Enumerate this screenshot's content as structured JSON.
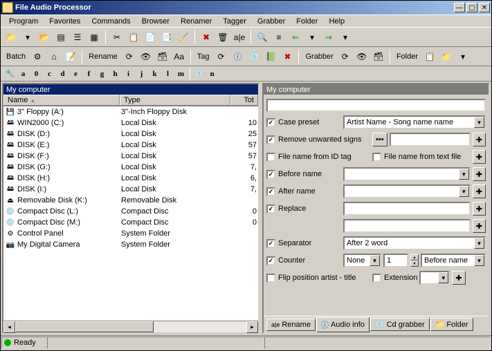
{
  "window": {
    "title": "File Audio Processor"
  },
  "menubar": [
    "Program",
    "Favorites",
    "Commands",
    "Browser",
    "Renamer",
    "Tagger",
    "Grabber",
    "Folder",
    "Help"
  ],
  "toolbar2": {
    "batch_label": "Batch",
    "rename_label": "Rename",
    "tag_label": "Tag",
    "grabber_label": "Grabber",
    "folder_label": "Folder"
  },
  "alpha": [
    "a",
    "0",
    "c",
    "d",
    "e",
    "f",
    "g",
    "h",
    "i",
    "j",
    "k",
    "l",
    "m",
    "n"
  ],
  "left": {
    "title": "My computer",
    "cols": {
      "name": "Name",
      "type": "Type",
      "total": "Tot"
    },
    "rows": [
      {
        "icon": "floppy",
        "name": "3\" Floppy (A:)",
        "type": "3\"-Inch Floppy Disk",
        "tot": ""
      },
      {
        "icon": "disk",
        "name": "WIN2000 (C:)",
        "type": "Local Disk",
        "tot": "10"
      },
      {
        "icon": "disk",
        "name": "DISK (D:)",
        "type": "Local Disk",
        "tot": "25"
      },
      {
        "icon": "disk-share",
        "name": "DISK (E:)",
        "type": "Local Disk",
        "tot": "57"
      },
      {
        "icon": "disk",
        "name": "DISK (F:)",
        "type": "Local Disk",
        "tot": "57"
      },
      {
        "icon": "disk",
        "name": "DISK (G:)",
        "type": "Local Disk",
        "tot": "7,"
      },
      {
        "icon": "disk",
        "name": "DISK (H:)",
        "type": "Local Disk",
        "tot": "6,"
      },
      {
        "icon": "disk",
        "name": "DISK (I:)",
        "type": "Local Disk",
        "tot": "7,"
      },
      {
        "icon": "removable",
        "name": "Removable Disk (K:)",
        "type": "Removable Disk",
        "tot": ""
      },
      {
        "icon": "cd",
        "name": "Compact Disc (L:)",
        "type": "Compact Disc",
        "tot": "0"
      },
      {
        "icon": "cd",
        "name": "Compact Disc (M:)",
        "type": "Compact Disc",
        "tot": "0"
      },
      {
        "icon": "control",
        "name": "Control Panel",
        "type": "System Folder",
        "tot": ""
      },
      {
        "icon": "camera",
        "name": "My Digital Camera",
        "type": "System Folder",
        "tot": ""
      }
    ]
  },
  "right": {
    "title": "My computer",
    "case_preset_label": "Case preset",
    "case_preset_value": "Artist Name - Song name name",
    "remove_unwanted": "Remove unwanted signs",
    "from_id_tag": "File name from ID tag",
    "from_text": "File name from text file",
    "before_name": "Before name",
    "after_name": "After name",
    "replace": "Replace",
    "separator": "Separator",
    "separator_value": "After 2 word",
    "counter": "Counter",
    "counter_none": "None",
    "counter_num": "1",
    "counter_pos": "Before name",
    "flip": "Flip position artist - title",
    "extension": "Extension"
  },
  "tabs": {
    "rename": "Rename",
    "audio": "Audio info",
    "cd": "Cd grabber",
    "folder": "Folder",
    "rename_prefix": "a|e"
  },
  "status": {
    "ready": "Ready",
    "led": "#00b000"
  }
}
